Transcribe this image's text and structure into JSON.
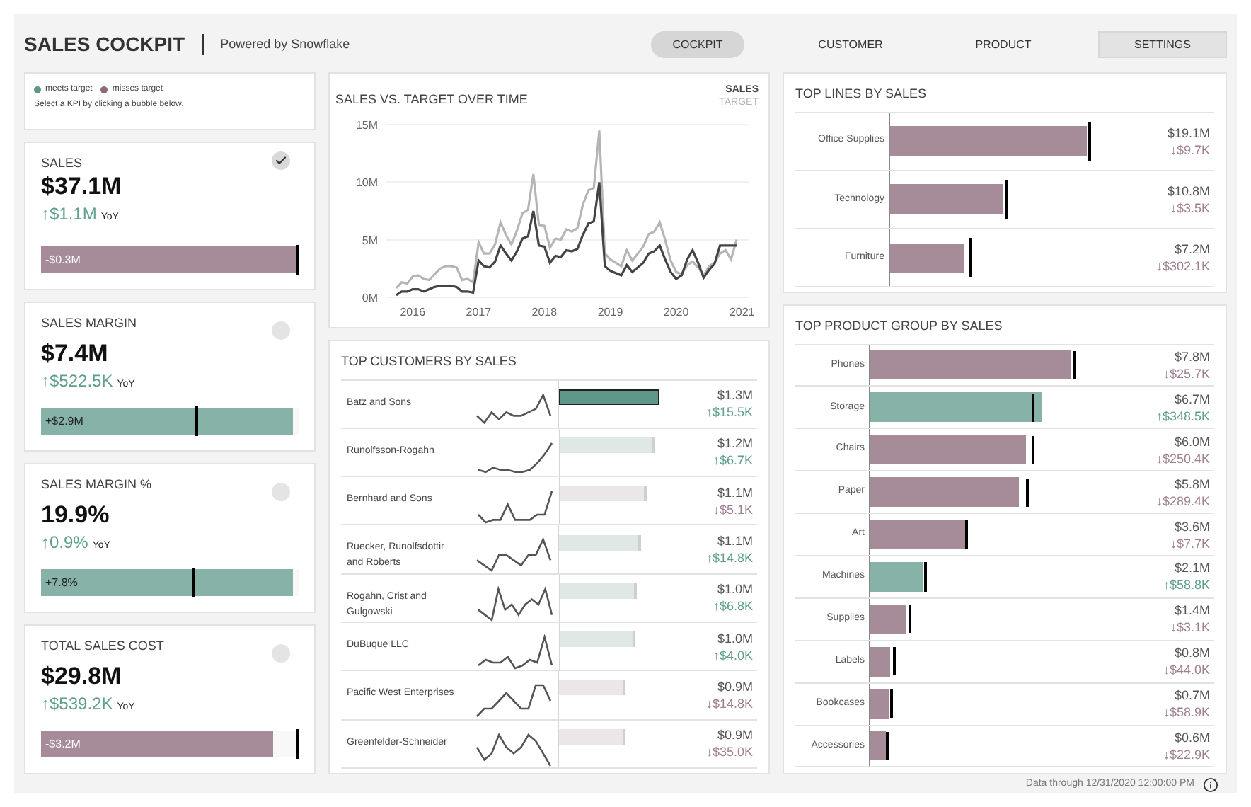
{
  "header": {
    "title": "SALES COCKPIT",
    "subtitle": "Powered by Snowflake"
  },
  "nav": {
    "tabs": [
      {
        "label": "COCKPIT",
        "selected": true
      },
      {
        "label": "CUSTOMER",
        "selected": false
      },
      {
        "label": "PRODUCT",
        "selected": false
      }
    ],
    "settings_button": "SETTINGS"
  },
  "legend": {
    "items": [
      {
        "label": "meets target",
        "color": "#5e9687"
      },
      {
        "label": "misses target",
        "color": "#8e6a7e"
      }
    ],
    "hint": "Select a KPI by clicking a bubble below."
  },
  "kpis": [
    {
      "title": "SALES",
      "value": "$37.1M",
      "change": "↑$1.1M",
      "change_up": true,
      "period": "YoY",
      "selected": true,
      "meets_target": false,
      "bar_label": "-$0.3M",
      "level": 0.99,
      "target": {
        "level": 1.0
      }
    },
    {
      "title": "SALES MARGIN",
      "value": "$7.4M",
      "change": "↑$522.5K",
      "change_up": true,
      "period": "YoY",
      "selected": false,
      "meets_target": true,
      "bar_label": "+$2.9M",
      "level": 0.98,
      "target": {
        "level": 0.61
      }
    },
    {
      "title": "SALES MARGIN %",
      "value": "19.9%",
      "change": "↑0.9%",
      "change_up": true,
      "period": "YoY",
      "selected": false,
      "meets_target": true,
      "bar_label": "+7.8%",
      "level": 0.98,
      "target": {
        "level": 0.6
      }
    },
    {
      "title": "TOTAL SALES COST",
      "value": "$29.8M",
      "change": "↑$539.2K",
      "change_up": true,
      "period": "YoY",
      "selected": false,
      "meets_target": false,
      "bar_label": "-$3.2M",
      "level": 0.9,
      "target": {
        "level": 1.0
      }
    }
  ],
  "trend": {
    "title": "SALES VS. TARGET OVER TIME",
    "chart_data": {
      "type": "line",
      "x": [
        2015.75,
        2015.833,
        2015.917,
        2016,
        2016.083,
        2016.167,
        2016.25,
        2016.333,
        2016.417,
        2016.5,
        2016.583,
        2016.667,
        2016.75,
        2016.833,
        2016.917,
        2017,
        2017.083,
        2017.167,
        2017.25,
        2017.333,
        2017.417,
        2017.5,
        2017.583,
        2017.667,
        2017.75,
        2017.833,
        2017.917,
        2018,
        2018.083,
        2018.167,
        2018.25,
        2018.333,
        2018.417,
        2018.5,
        2018.583,
        2018.667,
        2018.75,
        2018.833,
        2018.917,
        2019,
        2019.083,
        2019.167,
        2019.25,
        2019.333,
        2019.417,
        2019.5,
        2019.583,
        2019.667,
        2019.75,
        2019.833,
        2019.917,
        2020,
        2020.083,
        2020.167,
        2020.25,
        2020.333,
        2020.417,
        2020.5,
        2020.583,
        2020.667,
        2020.75,
        2020.833,
        2020.917
      ],
      "series": [
        {
          "name": "SALES",
          "color": "#444444",
          "values": [
            0.2,
            0.5,
            0.5,
            0.7,
            0.7,
            0.5,
            0.7,
            0.9,
            1.0,
            1.0,
            1.0,
            0.9,
            0.5,
            0.5,
            0.4,
            3.2,
            2.7,
            2.6,
            3.1,
            4.5,
            3.8,
            3.2,
            4.0,
            5.1,
            5.3,
            7.5,
            4.5,
            4.4,
            3.0,
            3.6,
            3.5,
            4.1,
            4.0,
            4.2,
            5.4,
            6.4,
            6.6,
            10.0,
            2.7,
            2.3,
            2.1,
            1.9,
            2.8,
            2.2,
            2.6,
            3.0,
            3.8,
            4.0,
            4.5,
            3.3,
            2.2,
            1.6,
            1.9,
            3.3,
            4.1,
            3.0,
            1.7,
            2.4,
            2.9,
            4.5,
            4.5,
            4.5,
            4.5
          ]
        },
        {
          "name": "TARGET",
          "color": "#b5b5b5",
          "values": [
            0.8,
            1.3,
            1.2,
            1.8,
            1.9,
            1.6,
            1.5,
            2.0,
            2.5,
            2.7,
            2.7,
            2.6,
            1.5,
            1.6,
            1.3,
            4.8,
            3.8,
            3.8,
            4.6,
            6.5,
            5.4,
            4.6,
            5.8,
            7.3,
            7.6,
            10.7,
            6.3,
            6.2,
            4.3,
            5.1,
            5.0,
            5.9,
            5.7,
            6.0,
            8.0,
            9.3,
            9.5,
            14.5,
            3.8,
            3.3,
            3.0,
            2.7,
            4.1,
            3.2,
            3.8,
            4.4,
            5.5,
            5.7,
            6.5,
            5.0,
            3.2,
            2.2,
            2.0,
            2.8,
            3.1,
            2.6,
            1.9,
            2.7,
            3.0,
            3.8,
            4.1,
            3.3,
            5.0
          ]
        }
      ],
      "xlim": [
        2015.6,
        2021.1
      ],
      "ylim": [
        0,
        15
      ],
      "grid": true,
      "xticks": [
        2016,
        2017,
        2018,
        2019,
        2020,
        2021
      ],
      "yticks": [
        {
          "value": 0,
          "label": "0M"
        },
        {
          "value": 5,
          "label": "5M"
        },
        {
          "value": 10,
          "label": "10M"
        },
        {
          "value": 15,
          "label": "15M"
        }
      ]
    }
  },
  "customers": {
    "title": "TOP CUSTOMERS BY SALES",
    "rows": [
      {
        "name": "Batz and Sons",
        "sales": "$1.3M",
        "change": "↑$15.5K",
        "meets_target": true,
        "selected": true,
        "level": 0.68
      },
      {
        "name": "Runolfsson-Rogahn",
        "sales": "$1.2M",
        "change": "↑$6.7K",
        "meets_target": true,
        "selected": false,
        "level": 0.63
      },
      {
        "name": "Bernhard and Sons",
        "sales": "$1.1M",
        "change": "↓$5.1K",
        "meets_target": false,
        "selected": false,
        "level": 0.58
      },
      {
        "name": "Ruecker, Runolfsdottir and Roberts",
        "sales": "$1.1M",
        "change": "↑$14.8K",
        "meets_target": true,
        "selected": false,
        "level": 0.56
      },
      {
        "name": "Rogahn, Crist and Gulgowski",
        "sales": "$1.0M",
        "change": "↑$6.8K",
        "meets_target": true,
        "selected": false,
        "level": 0.51
      },
      {
        "name": "DuBuque LLC",
        "sales": "$1.0M",
        "change": "↑$4.0K",
        "meets_target": true,
        "selected": false,
        "level": 0.5
      },
      {
        "name": "Pacific West Enterprises",
        "sales": "$0.9M",
        "change": "↓$14.8K",
        "meets_target": false,
        "selected": false,
        "level": 0.45
      },
      {
        "name": "Greenfelder-Schneider",
        "sales": "$0.9M",
        "change": "↓$35.0K",
        "meets_target": false,
        "selected": false,
        "level": 0.45
      }
    ]
  },
  "lines": {
    "title": "TOP LINES BY SALES",
    "rows": [
      {
        "name": "Office Supplies",
        "sales": "$19.1M",
        "change": "↓$9.7K",
        "meets_target": false,
        "level": 0.875,
        "target": {
          "level": 0.88
        }
      },
      {
        "name": "Technology",
        "sales": "$10.8M",
        "change": "↓$3.5K",
        "meets_target": false,
        "level": 0.5,
        "target": {
          "level": 0.51
        }
      },
      {
        "name": "Furniture",
        "sales": "$7.2M",
        "change": "↓$302.1K",
        "meets_target": false,
        "level": 0.33,
        "target": {
          "level": 0.35
        }
      }
    ]
  },
  "product_groups": {
    "title": "TOP PRODUCT GROUP BY SALES",
    "rows": [
      {
        "name": "Phones",
        "sales": "$7.8M",
        "change": "↓$25.7K",
        "meets_target": false,
        "level": 0.89,
        "target": {
          "level": 0.9
        }
      },
      {
        "name": "Storage",
        "sales": "$6.7M",
        "change": "↑$348.5K",
        "meets_target": true,
        "level": 0.76,
        "target": {
          "level": 0.72
        }
      },
      {
        "name": "Chairs",
        "sales": "$6.0M",
        "change": "↓$250.4K",
        "meets_target": false,
        "level": 0.69,
        "target": {
          "level": 0.72
        }
      },
      {
        "name": "Paper",
        "sales": "$5.8M",
        "change": "↓$289.4K",
        "meets_target": false,
        "level": 0.66,
        "target": {
          "level": 0.69
        }
      },
      {
        "name": "Art",
        "sales": "$3.6M",
        "change": "↓$7.7K",
        "meets_target": false,
        "level": 0.42,
        "target": {
          "level": 0.42
        }
      },
      {
        "name": "Machines",
        "sales": "$2.1M",
        "change": "↑$58.8K",
        "meets_target": true,
        "level": 0.23,
        "target": {
          "level": 0.24
        }
      },
      {
        "name": "Supplies",
        "sales": "$1.4M",
        "change": "↓$3.1K",
        "meets_target": false,
        "level": 0.16,
        "target": {
          "level": 0.17
        }
      },
      {
        "name": "Labels",
        "sales": "$0.8M",
        "change": "↓$44.0K",
        "meets_target": false,
        "level": 0.09,
        "target": {
          "level": 0.1
        }
      },
      {
        "name": "Bookcases",
        "sales": "$0.7M",
        "change": "↓$58.9K",
        "meets_target": false,
        "level": 0.08,
        "target": {
          "level": 0.09
        }
      },
      {
        "name": "Accessories",
        "sales": "$0.6M",
        "change": "↓$22.9K",
        "meets_target": false,
        "level": 0.07,
        "target": {
          "level": 0.07
        }
      }
    ]
  },
  "footer": {
    "text": "Data through 12/31/2020 12:00:00 PM"
  }
}
